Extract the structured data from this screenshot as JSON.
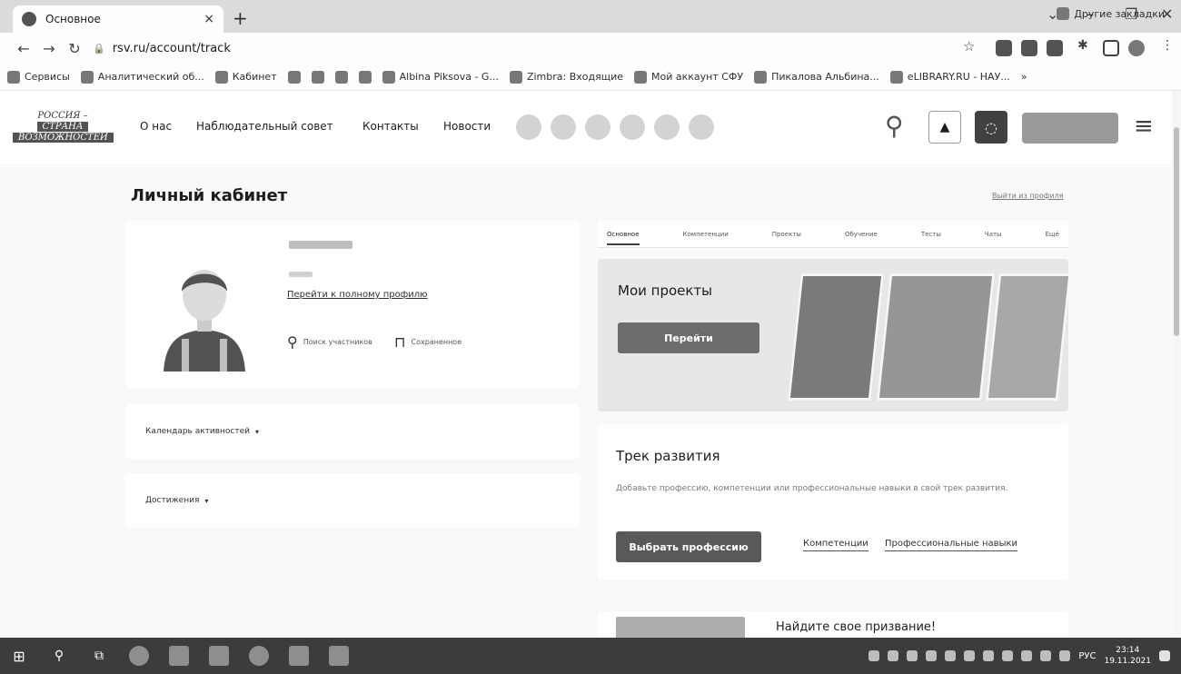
{
  "browser": {
    "tab_title": "Основное",
    "tab_close": "×",
    "new_tab": "+",
    "url": "rsv.ru/account/track",
    "bookmarks": [
      "Сервисы",
      "Аналитический об...",
      "Кабинет",
      "Albina Piksova - G...",
      "Zimbra: Входящие",
      "Мой аккаунт СФУ",
      "Пикалова Альбина...",
      "eLIBRARY.RU - НАУ..."
    ],
    "bookmarks_more": "»",
    "other_bookmarks": "Другие закладки"
  },
  "site": {
    "logo_line1": "РОССИЯ –",
    "logo_line2": "СТРАНА",
    "logo_line3": "ВОЗМОЖНОСТЕЙ",
    "nav": [
      "О нас",
      "Наблюдательный совет",
      "Контакты",
      "Новости"
    ]
  },
  "page": {
    "title": "Личный кабинет",
    "logout": "Выйти из профиля"
  },
  "profile": {
    "full_profile_link": "Перейти к полному профилю",
    "search_members": "Поиск участников",
    "saved": "Сохраненное"
  },
  "sections": {
    "calendar": "Календарь активностей",
    "achievements": "Достижения",
    "caret": "▾"
  },
  "tabs": [
    "Основное",
    "Компетенции",
    "Проекты",
    "Обучение",
    "Тесты",
    "Чаты",
    "Ещё"
  ],
  "projects": {
    "title": "Мои проекты",
    "button": "Перейти"
  },
  "track": {
    "title": "Трек развития",
    "description": "Добавьте профессию, компетенции или профессиональные навыки в свой трек развития.",
    "button": "Выбрать профессию",
    "link_competencies": "Компетенции",
    "link_skills": "Профессиональные навыки"
  },
  "calling": {
    "title": "Найдите свое призвание!"
  },
  "taskbar": {
    "language": "РУС",
    "time": "23:14",
    "date": "19.11.2021"
  }
}
